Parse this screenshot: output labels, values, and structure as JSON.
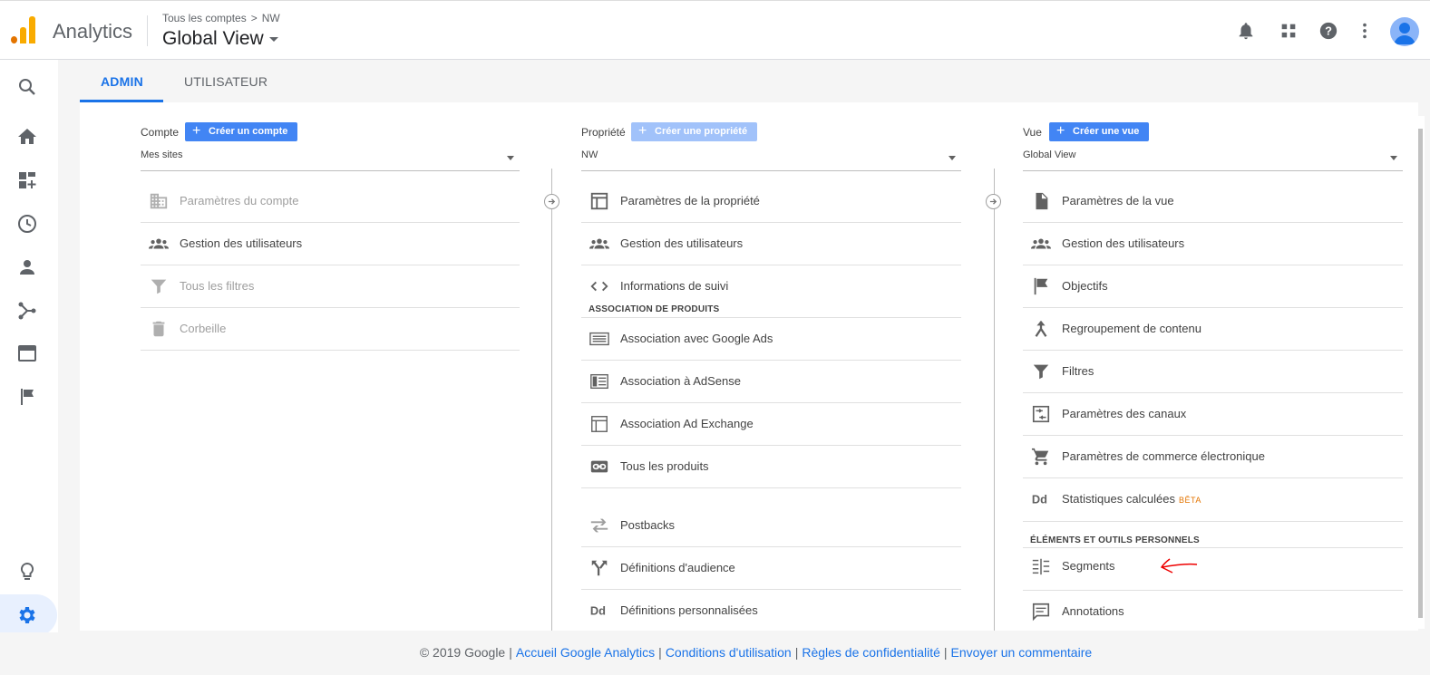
{
  "app": {
    "name": "Analytics",
    "accent": "#1a73e8",
    "logo_colors": [
      "#f9ab00",
      "#e37400"
    ]
  },
  "header": {
    "breadcrumb": {
      "accounts": "Tous les comptes",
      "separator": ">",
      "current": "NW"
    },
    "view_title": "Global View",
    "icons": [
      "bell-icon",
      "apps-grid-icon",
      "help-icon",
      "more-vert-icon",
      "avatar"
    ]
  },
  "left_nav": [
    "search-icon",
    "home-icon",
    "customization-icon",
    "realtime-icon",
    "audience-icon",
    "acquisition-icon",
    "behavior-icon",
    "conversions-icon",
    "discover-icon",
    "admin-gear-icon",
    "expand-icon"
  ],
  "tabs": [
    {
      "label": "ADMIN",
      "active": true
    },
    {
      "label": "UTILISATEUR",
      "active": false
    }
  ],
  "columns": {
    "account": {
      "label": "Compte",
      "create_label": "Créer un compte",
      "selected": "Mes sites",
      "items": [
        {
          "label": "Paramètres du compte",
          "icon": "building-icon",
          "disabled": true
        },
        {
          "label": "Gestion des utilisateurs",
          "icon": "users-icon",
          "disabled": false
        },
        {
          "label": "Tous les filtres",
          "icon": "filter-icon",
          "disabled": true
        },
        {
          "label": "Corbeille",
          "icon": "trash-icon",
          "disabled": true
        }
      ]
    },
    "property": {
      "label": "Propriété",
      "create_label": "Créer une propriété",
      "selected": "NW",
      "items": [
        {
          "label": "Paramètres de la propriété",
          "icon": "property-settings-icon"
        },
        {
          "label": "Gestion des utilisateurs",
          "icon": "users-icon"
        },
        {
          "label": "Informations de suivi",
          "icon": "code-icon"
        }
      ],
      "section": "ASSOCIATION DE PRODUITS",
      "product_items": [
        {
          "label": "Association avec Google Ads",
          "icon": "ads-icon"
        },
        {
          "label": "Association à AdSense",
          "icon": "adsense-icon"
        },
        {
          "label": "Association Ad Exchange",
          "icon": "adexchange-icon"
        },
        {
          "label": "Tous les produits",
          "icon": "link-icon"
        }
      ],
      "more_items": [
        {
          "label": "Postbacks",
          "icon": "postback-icon"
        },
        {
          "label": "Définitions d'audience",
          "icon": "audience-def-icon"
        },
        {
          "label": "Définitions personnalisées",
          "icon": "dd-icon"
        }
      ]
    },
    "view": {
      "label": "Vue",
      "create_label": "Créer une vue",
      "selected": "Global View",
      "items": [
        {
          "label": "Paramètres de la vue",
          "icon": "document-icon"
        },
        {
          "label": "Gestion des utilisateurs",
          "icon": "users-icon"
        },
        {
          "label": "Objectifs",
          "icon": "flag-icon"
        },
        {
          "label": "Regroupement de contenu",
          "icon": "merge-icon"
        },
        {
          "label": "Filtres",
          "icon": "filter-icon"
        },
        {
          "label": "Paramètres des canaux",
          "icon": "channel-icon"
        },
        {
          "label": "Paramètres de commerce électronique",
          "icon": "cart-icon"
        },
        {
          "label": "Statistiques calculées",
          "icon": "dd-icon",
          "badge": "BÊTA"
        }
      ],
      "section": "ÉLÉMENTS ET OUTILS PERSONNELS",
      "personal_items": [
        {
          "label": "Segments",
          "icon": "segments-icon"
        },
        {
          "label": "Annotations",
          "icon": "annotation-icon"
        }
      ]
    }
  },
  "footer": {
    "copyright": "© 2019 Google",
    "links": [
      "Accueil Google Analytics",
      "Conditions d'utilisation",
      "Règles de confidentialité",
      "Envoyer un commentaire"
    ],
    "separator": "|"
  }
}
